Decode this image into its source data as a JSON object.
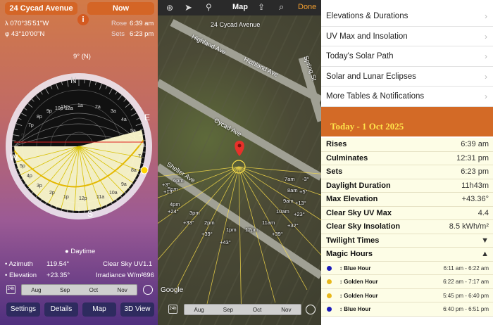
{
  "left_panel": {
    "location_button": "24 Cycad Avenue",
    "now_button": "Now",
    "longitude": "070°35'51\"W",
    "latitude": "43°10'00\"N",
    "info_label": "i",
    "rise_label": "Rose",
    "rise_time": "6:39 am",
    "set_label": "Sets",
    "set_time": "6:23 pm",
    "heading_label": "9° (N)",
    "compass": {
      "n": "N",
      "e": "E",
      "s": "S",
      "w": "W"
    },
    "hour_labels": [
      "12a",
      "1a",
      "2a",
      "3a",
      "4a",
      "5a",
      "6a",
      "7a",
      "8a",
      "9a",
      "10a",
      "11a",
      "12p",
      "1p",
      "2p",
      "3p",
      "4p",
      "5p",
      "6p",
      "7p",
      "8p",
      "9p",
      "10p",
      "11p",
      "12a"
    ],
    "daytime_label": "Daytime",
    "azimuth_label": "Azimuth",
    "azimuth_value": "119.54°",
    "elevation_label": "Elevation",
    "elevation_value": "+23.35°",
    "uv_label": "Clear Sky UV",
    "uv_value": "1.1",
    "irradiance_label": "Irradiance W/m²",
    "irradiance_value": "696",
    "timebar_toggle": "24h",
    "months": [
      "Aug",
      "Sep",
      "Oct",
      "Nov"
    ],
    "buttons": [
      "Settings",
      "Details",
      "Map",
      "3D View"
    ]
  },
  "middle_panel": {
    "title": "Map",
    "done": "Done",
    "location_label": "24 Cycad Avenue",
    "streets": [
      "Highland Ave",
      "Highland Ave",
      "Cycad Ave",
      "Shelter Ave",
      "Spring St"
    ],
    "sun_times": [
      {
        "t": "7am",
        "e": "-3°"
      },
      {
        "t": "8am",
        "e": "+5°"
      },
      {
        "t": "9am",
        "e": "+13°"
      },
      {
        "t": "10am",
        "e": "+23°"
      },
      {
        "t": "11am",
        "e": "+32°"
      },
      {
        "t": "12pm",
        "e": "+39°"
      },
      {
        "t": "1pm",
        "e": "+43°"
      },
      {
        "t": "2pm",
        "e": "+39°"
      },
      {
        "t": "3pm",
        "e": "+33°"
      },
      {
        "t": "4pm",
        "e": "+24°"
      },
      {
        "t": "5pm",
        "e": "+13°"
      },
      {
        "t": "6pm",
        "e": "+3°"
      }
    ],
    "google": "Google",
    "timebar_toggle": "24h",
    "months": [
      "Aug",
      "Sep",
      "Oct",
      "Nov"
    ]
  },
  "right_panel": {
    "menu": [
      "Elevations & Durations",
      "UV Max and Insolation",
      "Today's Solar Path",
      "Solar and Lunar Eclipses",
      "More Tables & Notifications"
    ],
    "today_title": "Today - 1 Oct 2025",
    "rows": [
      {
        "k": "Rises",
        "v": "6:39 am"
      },
      {
        "k": "Culminates",
        "v": "12:31 pm"
      },
      {
        "k": "Sets",
        "v": "6:23 pm"
      },
      {
        "k": "Daylight Duration",
        "v": "11h43m"
      },
      {
        "k": "Max Elevation",
        "v": "+43.36°"
      },
      {
        "k": "Clear Sky UV Max",
        "v": "4.4"
      },
      {
        "k": "Clear Sky Insolation",
        "v": "8.5 kWh/m²"
      },
      {
        "k": "Twilight Times",
        "v": "▼"
      },
      {
        "k": "Magic Hours",
        "v": "▲"
      }
    ],
    "magic": [
      {
        "name": "↕ Blue Hour",
        "time": "6:11 am - 6:22 am",
        "color": "#1a1ab8"
      },
      {
        "name": "↕ Golden Hour",
        "time": "6:22 am - 7:17 am",
        "color": "#e8b81a"
      },
      {
        "name": "↕ Golden Hour",
        "time": "5:45 pm - 6:40 pm",
        "color": "#e8b81a"
      },
      {
        "name": "↕ Blue Hour",
        "time": "6:40 pm - 6:51 pm",
        "color": "#1a1ab8"
      }
    ]
  }
}
